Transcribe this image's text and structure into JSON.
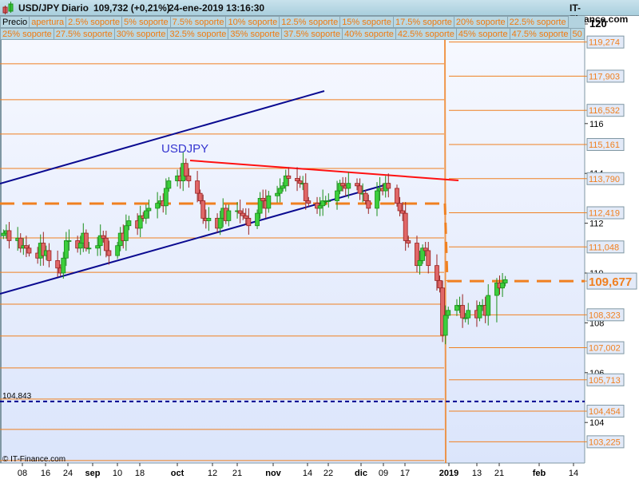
{
  "header": {
    "symbol": "USD/JPY",
    "period": "Diario",
    "quote": "109,732 (+0,21%)",
    "datetime": "24-ene-2019 13:16:30",
    "brand": "IT-Finance.com"
  },
  "legend": {
    "row1": [
      "Precio",
      "apertura",
      "2.5% soporte",
      "5% soporte",
      "7.5% soporte",
      "10% soporte",
      "12.5% soporte",
      "15% soporte",
      "17.5% soporte",
      "20% soporte",
      "22.5% soporte"
    ],
    "row2": [
      "25% soporte",
      "27.5% soporte",
      "30% soporte",
      "32.5% soporte",
      "35% soporte",
      "37.5% soporte",
      "40% soporte",
      "42.5% soporte",
      "45% soporte",
      "47.5% soporte",
      "50"
    ]
  },
  "colors": {
    "up": "#3ccf3c",
    "up_border": "#1a8f1a",
    "down": "#e06767",
    "down_border": "#992222",
    "level": "#f08020",
    "trend_blue": "#0a0a90",
    "trend_red": "#ff1010",
    "dotted": "#000090"
  },
  "chart_data": {
    "type": "candlestick",
    "title": "USD/JPY Diario",
    "annotation": "USDJPY",
    "start_date": "2018-08-01",
    "closes": [
      111.6,
      111.7,
      111.3,
      111.4,
      111.0,
      111.1,
      111.0,
      110.8,
      110.6,
      111.2,
      110.7,
      110.9,
      110.5,
      110.2,
      110.0,
      110.6,
      111.3,
      111.3,
      111.0,
      111.2,
      111.6,
      111.0,
      111.0,
      111.1,
      111.5,
      111.4,
      110.9,
      110.7,
      111.1,
      111.6,
      111.3,
      111.9,
      112.1,
      111.8,
      112.3,
      112.2,
      112.5,
      112.6,
      112.8,
      112.9,
      112.7,
      113.4,
      113.7,
      113.9,
      113.7,
      114.4,
      113.9,
      113.7,
      113.2,
      112.9,
      112.2,
      112.1,
      112.2,
      111.8,
      112.2,
      112.6,
      112.1,
      112.5,
      112.5,
      112.4,
      112.3,
      112.2,
      111.9,
      112.4,
      113.0,
      112.9,
      112.6,
      113.1,
      113.2,
      113.4,
      113.5,
      113.9,
      113.8,
      113.7,
      113.6,
      113.6,
      112.9,
      112.8,
      112.6,
      112.7,
      112.9,
      112.9,
      112.9,
      113.3,
      113.6,
      113.5,
      113.4,
      113.6,
      113.5,
      113.2,
      113.2,
      112.9,
      112.6,
      113.3,
      113.4,
      113.3,
      113.6,
      113.4,
      112.8,
      112.5,
      112.4,
      111.3,
      111.2,
      110.3,
      110.5,
      111.0,
      110.9,
      110.3,
      109.7,
      109.4,
      107.5,
      108.3,
      108.5,
      108.7,
      108.7,
      108.2,
      108.2,
      108.5,
      108.2,
      108.7,
      108.7,
      108.3,
      109.1,
      109.6,
      109.4,
      109.6,
      109.732
    ],
    "ylim": [
      102,
      120.5
    ],
    "y_ticks": [
      "120",
      "116",
      "114",
      "112",
      "110",
      "108",
      "106",
      "104"
    ],
    "x_ticks": [
      "08",
      "16",
      "24",
      "sep",
      "10",
      "18",
      "oct",
      "12",
      "21",
      "nov",
      "14",
      "22",
      "dic",
      "09",
      "17",
      "2019",
      "13",
      "21",
      "feb",
      "14"
    ],
    "left_levels": [
      118.4,
      116.96,
      115.58,
      114.2,
      112.79,
      111.41,
      110.03,
      108.75,
      107.47,
      106.19,
      104.94,
      103.72,
      102.47
    ],
    "left_open": 112.79,
    "right_open": "109,677",
    "right_levels": [
      "119,274",
      "117,903",
      "116,532",
      "115,161",
      "113,790",
      "112,419",
      "111,048",
      "108,323",
      "107,002",
      "105,713",
      "104,454",
      "103,225"
    ],
    "dotted_level": "104,843",
    "trendlines": [
      "upper channel",
      "lower channel",
      "resistance"
    ],
    "copyright": "© IT-Finance.com"
  }
}
